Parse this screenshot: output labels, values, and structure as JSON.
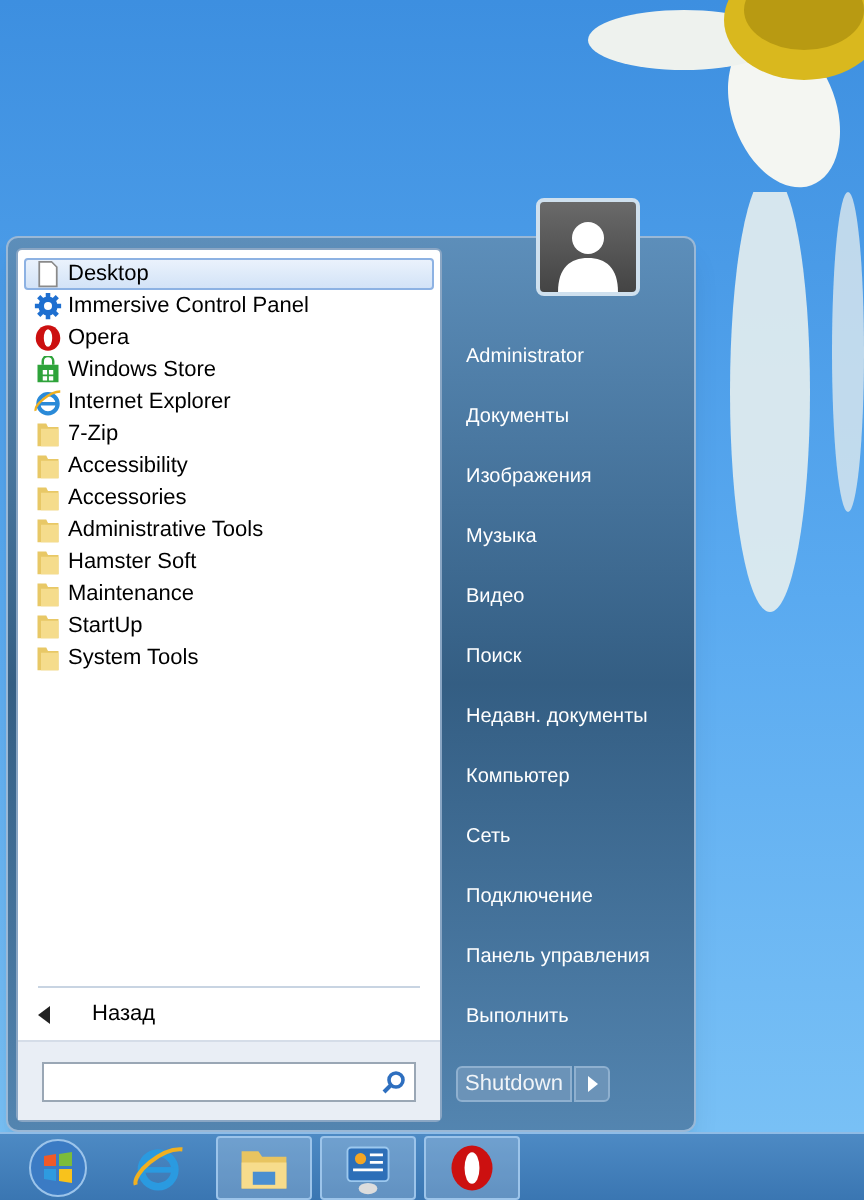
{
  "start_menu": {
    "programs": [
      {
        "label": "Desktop",
        "kind": "document",
        "selected": true
      },
      {
        "label": "Immersive Control Panel",
        "kind": "gear",
        "selected": false
      },
      {
        "label": "Opera",
        "kind": "opera",
        "selected": false
      },
      {
        "label": "Windows Store",
        "kind": "store",
        "selected": false
      },
      {
        "label": "Internet Explorer",
        "kind": "ie",
        "selected": false
      },
      {
        "label": "7-Zip",
        "kind": "folder",
        "selected": false
      },
      {
        "label": "Accessibility",
        "kind": "folder",
        "selected": false
      },
      {
        "label": "Accessories",
        "kind": "folder",
        "selected": false
      },
      {
        "label": "Administrative Tools",
        "kind": "folder",
        "selected": false
      },
      {
        "label": "Hamster Soft",
        "kind": "folder",
        "selected": false
      },
      {
        "label": "Maintenance",
        "kind": "folder",
        "selected": false
      },
      {
        "label": "StartUp",
        "kind": "folder",
        "selected": false
      },
      {
        "label": "System Tools",
        "kind": "folder",
        "selected": false
      }
    ],
    "back_label": "Назад",
    "places": [
      "Administrator",
      "Документы",
      "Изображения",
      "Музыка",
      "Видео",
      "Поиск",
      "Недавн. документы",
      "Компьютер",
      "Сеть",
      "Подключение",
      "Панель управления",
      "Выполнить"
    ],
    "shutdown_label": "Shutdown"
  },
  "taskbar": {
    "items": [
      {
        "kind": "ie",
        "running": false
      },
      {
        "kind": "explorer",
        "running": true
      },
      {
        "kind": "control",
        "running": true
      },
      {
        "kind": "opera",
        "running": true
      }
    ]
  }
}
